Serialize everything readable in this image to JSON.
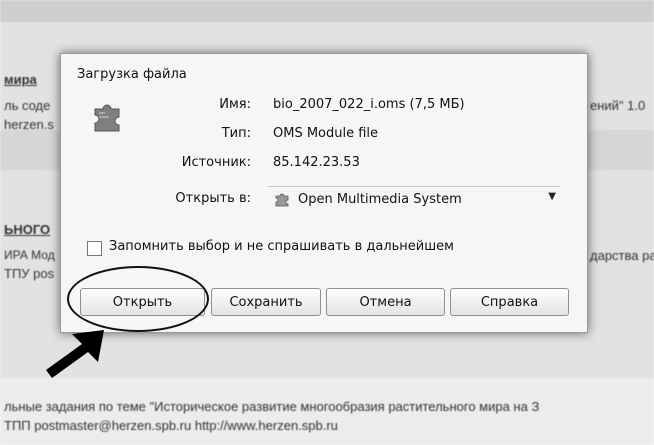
{
  "background": {
    "lines": [
      {
        "text": "мира"
      },
      {
        "text": "ль соде"
      },
      {
        "text": "herzen.s"
      },
      {
        "text": "ений\" 1.0"
      },
      {
        "text": "ЬНОГО"
      },
      {
        "text": "ИРА Мод"
      },
      {
        "text": "ТПУ pos"
      },
      {
        "text": "дарства ра"
      },
      {
        "text": "льные задания по теме \"Историческое развитие многообразия растительного мира на З"
      },
      {
        "text": "ТПП postmaster@herzen.spb.ru http://www.herzen.spb.ru"
      }
    ]
  },
  "dialog": {
    "title": "Загрузка файла",
    "icon": "puzzle-piece-icon",
    "name_label": "Имя:",
    "name_value": "bio_2007_022_i.oms (7,5 МБ)",
    "type_label": "Тип:",
    "type_value": "OMS Module file",
    "source_label": "Источник:",
    "source_value": "85.142.23.53",
    "open_with_label": "Открыть в:",
    "open_with_value": "Open Multimedia System",
    "remember_label": "Запомнить выбор и не спрашивать в дальнейшем",
    "remember_checked": false,
    "buttons": {
      "open": "Открыть",
      "save": "Сохранить",
      "cancel": "Отмена",
      "help": "Справка"
    }
  },
  "annotations": {
    "highlight": "ellipse around open button",
    "pointer": "arrow pointing at open button"
  }
}
